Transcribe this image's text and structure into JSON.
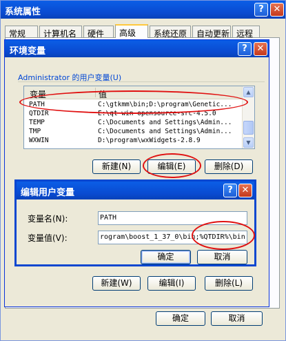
{
  "outer": {
    "title": "系统属性",
    "tabs": [
      "常规",
      "计算机名",
      "硬件",
      "高级",
      "系统还原",
      "自动更新",
      "远程"
    ],
    "active_tab": "高级",
    "ok_label": "确定",
    "cancel_label": "取消"
  },
  "env": {
    "title": "环境变量",
    "user_group_label": "Administrator 的用户变量(U)",
    "columns": [
      "变量",
      "值"
    ],
    "rows": [
      {
        "name": "PATH",
        "value": "C:\\gtkmm\\bin;D:\\program\\Genetic..."
      },
      {
        "name": "QTDIR",
        "value": "E:\\qt-win-opensource-src-4.5.0"
      },
      {
        "name": "TEMP",
        "value": "C:\\Documents and Settings\\Admin..."
      },
      {
        "name": "TMP",
        "value": "C:\\Documents and Settings\\Admin..."
      },
      {
        "name": "WXWIN",
        "value": "D:\\program\\wxWidgets-2.8.9"
      }
    ],
    "user_buttons": {
      "new": "新建(N)",
      "edit": "编辑(E)",
      "delete": "删除(D)"
    },
    "system_buttons": {
      "new": "新建(W)",
      "edit": "编辑(I)",
      "delete": "删除(L)"
    }
  },
  "edit_dialog": {
    "title": "编辑用户变量",
    "name_label": "变量名(N):",
    "name_value": "PATH",
    "value_label": "变量值(V):",
    "value_value": "rogram\\boost_1_37_0\\bin;%QTDIR%\\bin",
    "ok_label": "确定",
    "cancel_label": "取消"
  },
  "icons": {
    "help": "question-mark",
    "close": "x-mark"
  },
  "colors": {
    "title_blue": "#0a4ad0",
    "annotation_red": "#e01010",
    "dialog_bg": "#ece9d8"
  }
}
